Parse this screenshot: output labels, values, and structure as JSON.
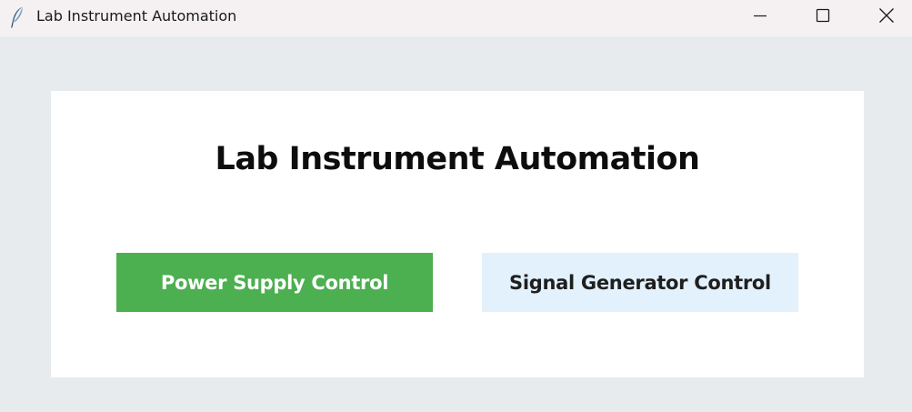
{
  "window": {
    "title": "Lab Instrument Automation",
    "icon": "feather-icon"
  },
  "window_controls": {
    "minimize": "minimize-icon",
    "maximize": "maximize-icon",
    "close": "close-icon"
  },
  "main": {
    "heading": "Lab Instrument Automation",
    "buttons": [
      {
        "label": "Power Supply Control",
        "background": "#4caf50",
        "text_color": "#ffffff"
      },
      {
        "label": "Signal Generator Control",
        "background": "#e3f1fd",
        "text_color": "#1f1f1f"
      }
    ]
  },
  "colors": {
    "titlebar": "#f5f1f2",
    "window_background": "#e8ebee",
    "card_background": "#ffffff"
  }
}
